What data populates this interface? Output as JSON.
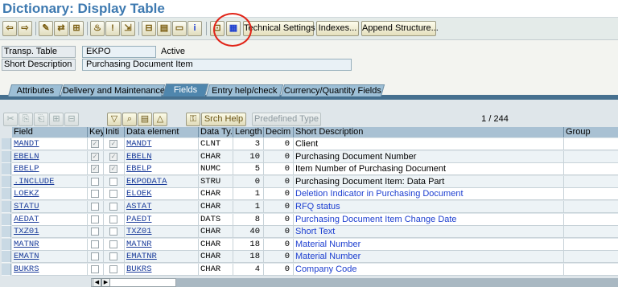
{
  "title": "Dictionary: Display Table",
  "toolbar": {
    "icons": [
      {
        "name": "back-icon",
        "glyph": "⇦"
      },
      {
        "name": "forward-icon",
        "glyph": "⇨"
      },
      {
        "name": "display-change-icon",
        "glyph": "✎"
      },
      {
        "name": "other-object-icon",
        "glyph": "⇄"
      },
      {
        "name": "check-icon",
        "glyph": "⊞"
      },
      {
        "name": "activate-icon",
        "glyph": "♨"
      },
      {
        "name": "where-used-icon",
        "glyph": "!"
      },
      {
        "name": "navigate-icon",
        "glyph": "⇲"
      },
      {
        "name": "hierarchy-icon",
        "glyph": "⊟"
      },
      {
        "name": "object-list-icon",
        "glyph": "▤"
      },
      {
        "name": "display-object-icon",
        "glyph": "▭"
      },
      {
        "name": "info-icon",
        "glyph": "i"
      },
      {
        "name": "graphic-icon",
        "glyph": "⊡"
      },
      {
        "name": "contents-icon",
        "glyph": "▦"
      }
    ],
    "buttons": [
      "Technical Settings",
      "Indexes...",
      "Append Structure..."
    ]
  },
  "header": {
    "table_label": "Transp. Table",
    "table_value": "EKPO",
    "status": "Active",
    "desc_label": "Short Description",
    "desc_value": "Purchasing Document Item"
  },
  "tabs": [
    "Attributes",
    "Delivery and Maintenance",
    "Fields",
    "Entry help/check",
    "Currency/Quantity Fields"
  ],
  "active_tab": "Fields",
  "grid_toolbar": {
    "srch_help": "Srch Help",
    "predefined_type": "Predefined Type",
    "counter": "1  /  244"
  },
  "columns": [
    "Field",
    "Key",
    "Initi",
    "Data element",
    "Data Ty.",
    "Length",
    "Decim",
    "Short Description",
    "Group"
  ],
  "rows": [
    {
      "field": "MANDT",
      "key": true,
      "init": true,
      "elem": "MANDT",
      "type": "CLNT",
      "length": "3",
      "decim": "0",
      "desc": "Client",
      "blue": false
    },
    {
      "field": "EBELN",
      "key": true,
      "init": true,
      "elem": "EBELN",
      "type": "CHAR",
      "length": "10",
      "decim": "0",
      "desc": "Purchasing Document Number",
      "blue": false
    },
    {
      "field": "EBELP",
      "key": true,
      "init": true,
      "elem": "EBELP",
      "type": "NUMC",
      "length": "5",
      "decim": "0",
      "desc": "Item Number of Purchasing Document",
      "blue": false
    },
    {
      "field": ".INCLUDE",
      "key": false,
      "init": false,
      "elem": "EKPODATA",
      "type": "STRU",
      "length": "0",
      "decim": "0",
      "desc": "Purchasing Document Item: Data Part",
      "blue": false
    },
    {
      "field": "LOEKZ",
      "key": false,
      "init": false,
      "elem": "ELOEK",
      "type": "CHAR",
      "length": "1",
      "decim": "0",
      "desc": "Deletion Indicator in Purchasing Document",
      "blue": true
    },
    {
      "field": "STATU",
      "key": false,
      "init": false,
      "elem": "ASTAT",
      "type": "CHAR",
      "length": "1",
      "decim": "0",
      "desc": "RFQ status",
      "blue": true
    },
    {
      "field": "AEDAT",
      "key": false,
      "init": false,
      "elem": "PAEDT",
      "type": "DATS",
      "length": "8",
      "decim": "0",
      "desc": "Purchasing Document Item Change Date",
      "blue": true
    },
    {
      "field": "TXZ01",
      "key": false,
      "init": false,
      "elem": "TXZ01",
      "type": "CHAR",
      "length": "40",
      "decim": "0",
      "desc": "Short Text",
      "blue": true
    },
    {
      "field": "MATNR",
      "key": false,
      "init": false,
      "elem": "MATNR",
      "type": "CHAR",
      "length": "18",
      "decim": "0",
      "desc": "Material Number",
      "blue": true
    },
    {
      "field": "EMATN",
      "key": false,
      "init": false,
      "elem": "EMATNR",
      "type": "CHAR",
      "length": "18",
      "decim": "0",
      "desc": "Material Number",
      "blue": true
    },
    {
      "field": "BUKRS",
      "key": false,
      "init": false,
      "elem": "BUKRS",
      "type": "CHAR",
      "length": "4",
      "decim": "0",
      "desc": "Company Code",
      "blue": true
    }
  ],
  "colors": {
    "title": "#3d79b0",
    "tab_active": "#4f86ad",
    "highlight_circle": "#e12418"
  }
}
